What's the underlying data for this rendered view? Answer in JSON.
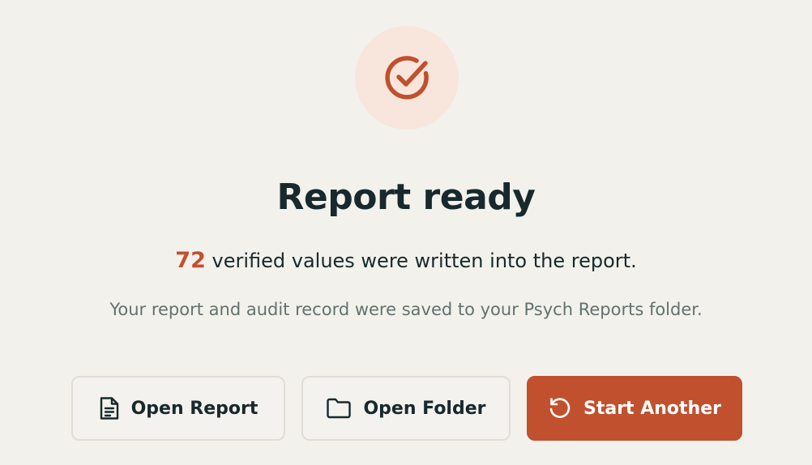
{
  "status": {
    "icon": "check-circle-icon",
    "title": "Report ready",
    "verified_count": "72",
    "summary_text": " verified values were written into the report.",
    "note": "Your report and audit record were saved to your Psych Reports folder."
  },
  "actions": {
    "open_report": {
      "label": "Open Report",
      "icon": "document-icon"
    },
    "open_folder": {
      "label": "Open Folder",
      "icon": "folder-icon"
    },
    "start_another": {
      "label": "Start Another",
      "icon": "restart-icon"
    }
  },
  "colors": {
    "accent": "#c1502e",
    "badge_background": "#f8e6dd",
    "page_background": "#f3f1ec",
    "title_text": "#17292c",
    "muted_text": "#63716f"
  }
}
